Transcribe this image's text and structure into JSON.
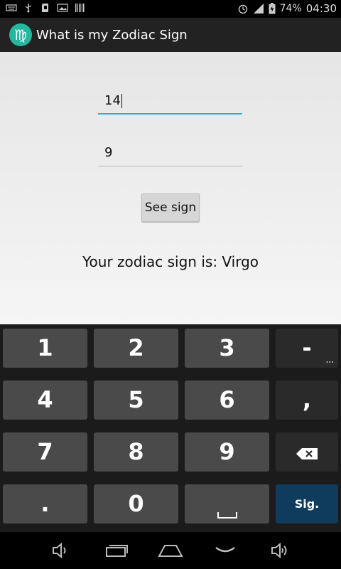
{
  "status_bar": {
    "battery_percent": "74%",
    "time": "04:30",
    "icons": [
      "keyboard-icon",
      "usb-icon",
      "sd-card-icon",
      "image-icon",
      "barcode-icon",
      "alarm-icon",
      "signal-icon",
      "battery-icon"
    ]
  },
  "app": {
    "title": "What is my Zodiac Sign",
    "icon_glyph": "♍"
  },
  "form": {
    "day_value": "14",
    "month_value": "9",
    "button_label": "See sign",
    "result_text": "Your zodiac sign is: Virgo"
  },
  "keyboard": {
    "keys": {
      "k1": "1",
      "k2": "2",
      "k3": "3",
      "dash": "-",
      "k4": "4",
      "k5": "5",
      "k6": "6",
      "comma": ",",
      "k7": "7",
      "k8": "8",
      "k9": "9",
      "dot": ".",
      "k0": "0",
      "action": "Sig.",
      "more": "..."
    }
  },
  "nav_bar": {
    "icons": [
      "volume-down-icon",
      "recent-apps-icon",
      "home-icon",
      "hide-keyboard-icon",
      "volume-up-icon"
    ]
  },
  "colors": {
    "accent": "#33a9d6",
    "app_icon": "#25b8a0",
    "action_key": "#0f3c5c"
  }
}
